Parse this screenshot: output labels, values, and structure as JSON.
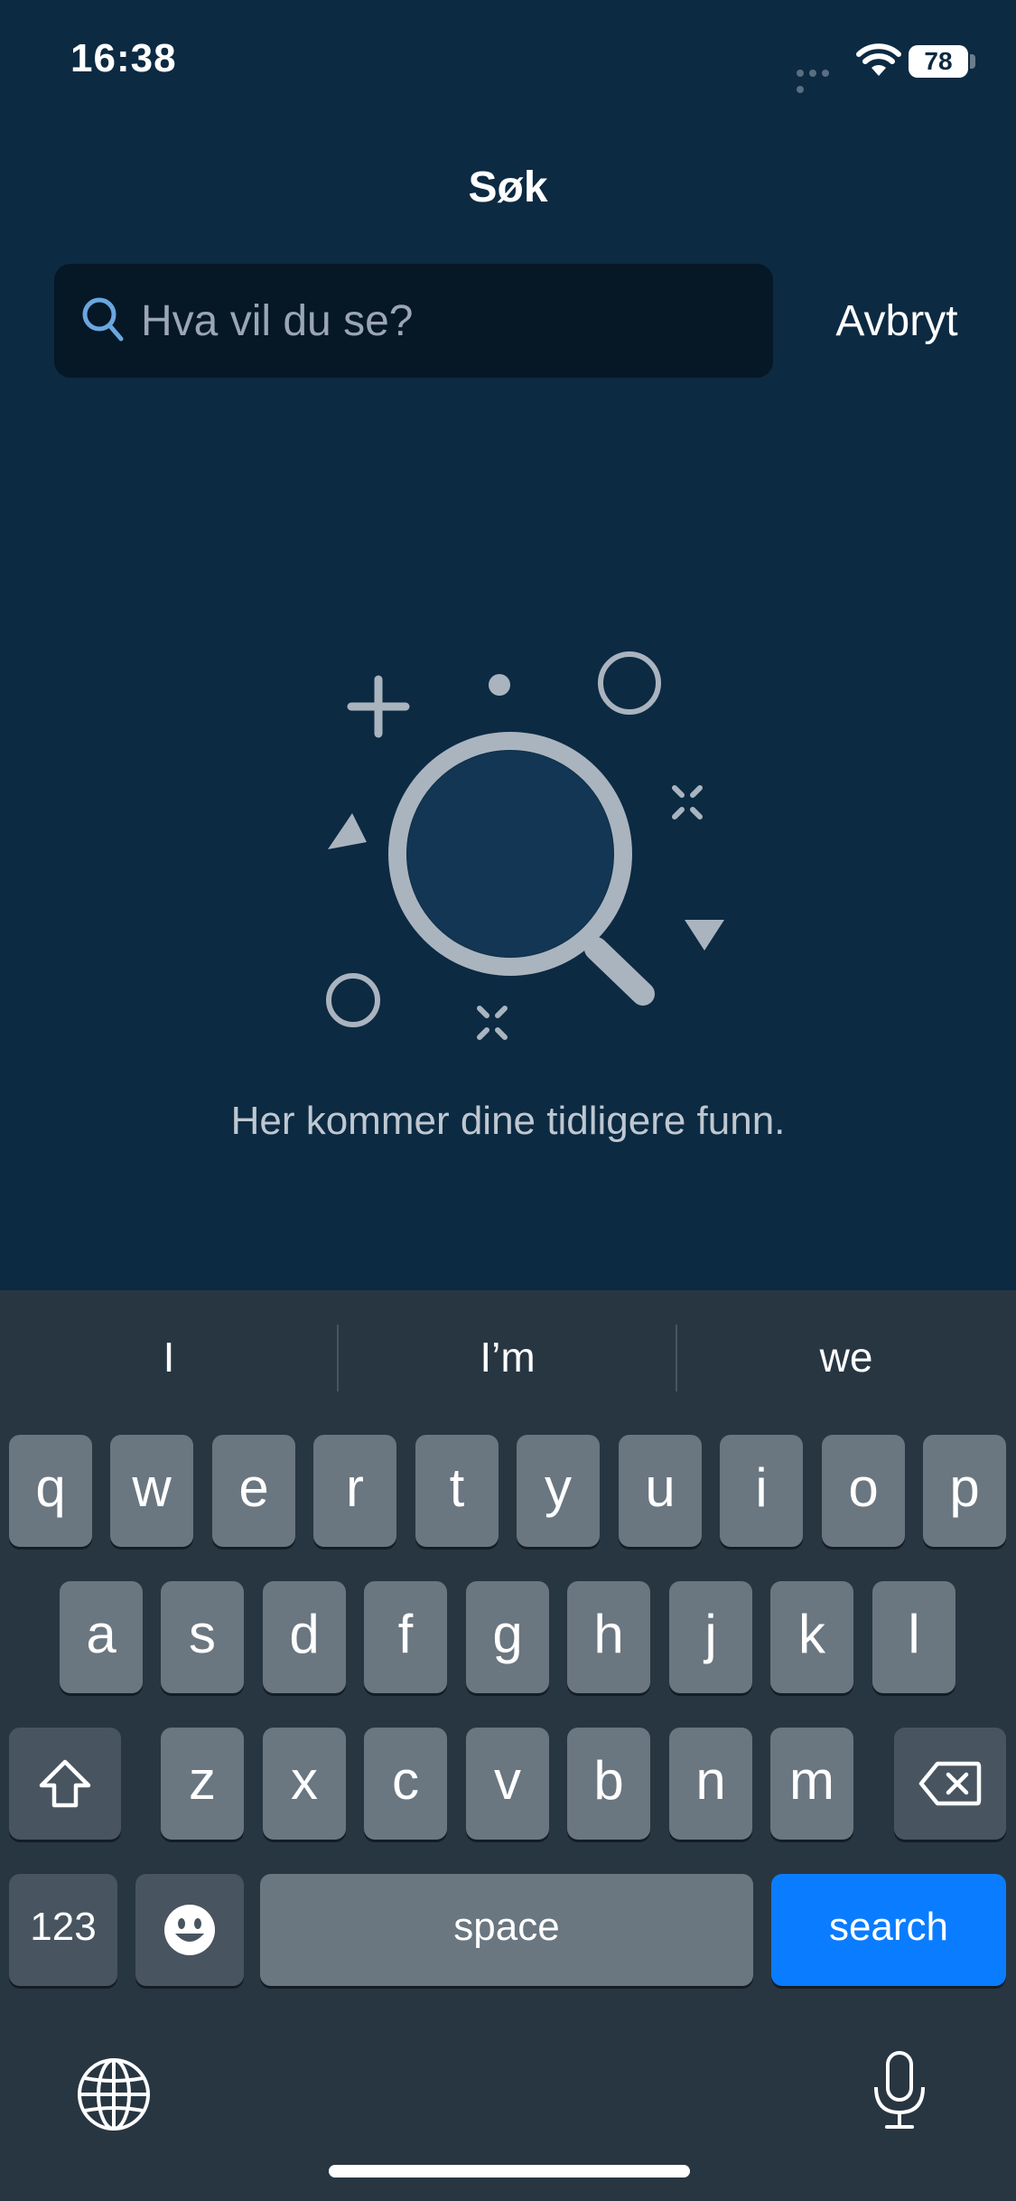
{
  "status_bar": {
    "time": "16:38",
    "battery": "78"
  },
  "header": {
    "title": "Søk"
  },
  "search": {
    "placeholder": "Hva vil du se?",
    "value": "",
    "cancel_label": "Avbryt"
  },
  "empty_state": {
    "text": "Her kommer dine tidligere funn.",
    "illustration_icon": "magnifying-glass-icon"
  },
  "keyboard": {
    "suggestions": [
      "I",
      "I’m",
      "we"
    ],
    "row1": [
      "q",
      "w",
      "e",
      "r",
      "t",
      "y",
      "u",
      "i",
      "o",
      "p"
    ],
    "row2": [
      "a",
      "s",
      "d",
      "f",
      "g",
      "h",
      "j",
      "k",
      "l"
    ],
    "row3": [
      "z",
      "x",
      "c",
      "v",
      "b",
      "n",
      "m"
    ],
    "numbers_label": "123",
    "space_label": "space",
    "search_label": "search"
  },
  "colors": {
    "background": "#0c2a42",
    "search_field": "#061726",
    "keyboard": "#283642",
    "key": "#6a7680",
    "key_dark": "#48545f",
    "search_key": "#0a7cff"
  }
}
